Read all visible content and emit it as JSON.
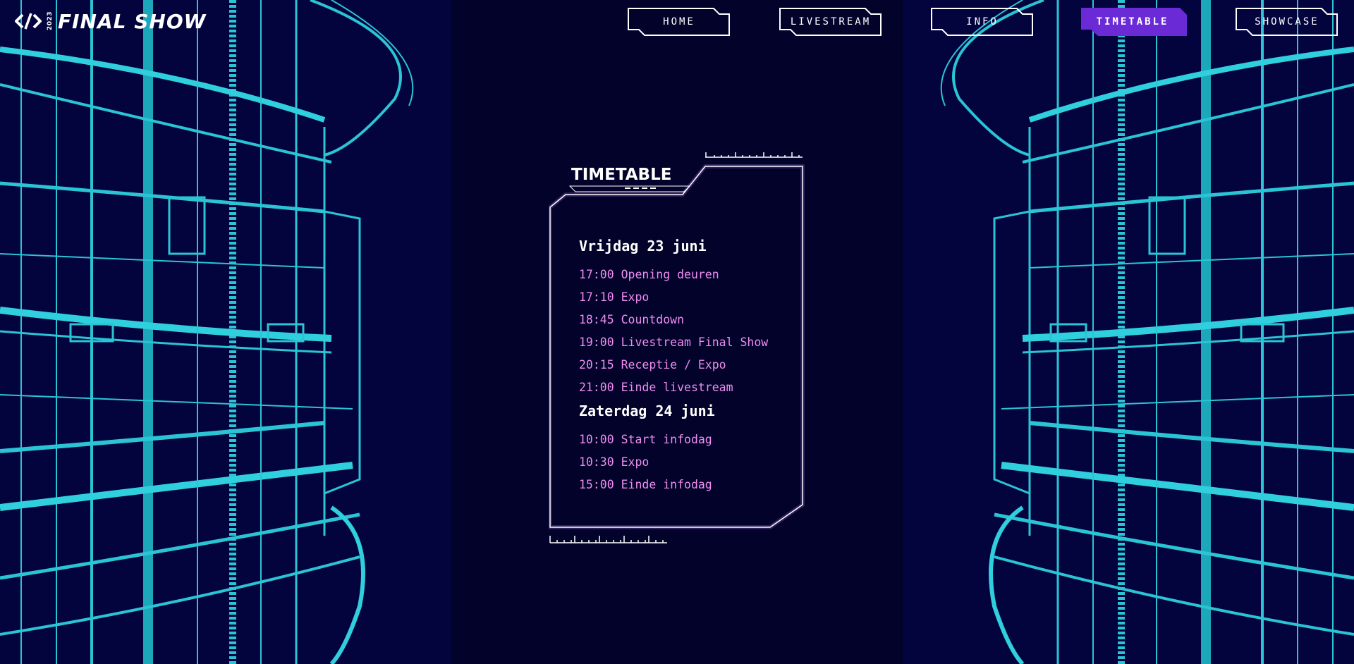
{
  "brand": {
    "year": "2023",
    "name": "FINAL SHOW"
  },
  "nav": {
    "items": [
      {
        "label": "HOME",
        "active": false
      },
      {
        "label": "LIVESTREAM",
        "active": false
      },
      {
        "label": "INFO",
        "active": false
      },
      {
        "label": "TIMETABLE",
        "active": true
      },
      {
        "label": "SHOWCASE",
        "active": false
      }
    ]
  },
  "timetable": {
    "title": "TIMETABLE",
    "days": [
      {
        "title": "Vrijdag 23 juni",
        "events": [
          "17:00 Opening deuren",
          "17:10 Expo",
          "18:45 Countdown",
          "19:00 Livestream Final Show",
          "20:15 Receptie / Expo",
          "21:00 Einde livestream"
        ]
      },
      {
        "title": "Zaterdag 24 juni",
        "events": [
          "10:00 Start infodag",
          "10:30 Expo",
          "15:00 Einde infodag"
        ]
      }
    ]
  },
  "colors": {
    "background": "#02022a",
    "accent_active": "#6a2bd6",
    "event_text": "#ee8df0",
    "art_cyan": "#33e8ee"
  },
  "icons": {
    "logo": "code-brackets-icon"
  }
}
